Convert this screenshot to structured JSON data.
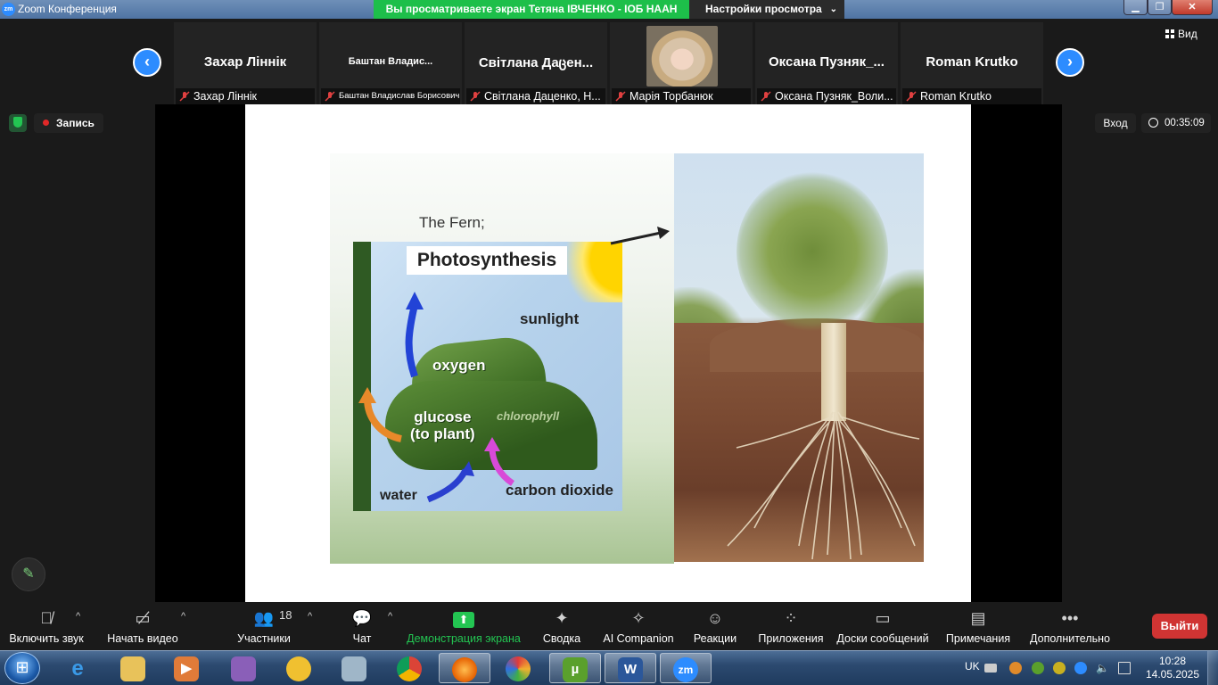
{
  "window": {
    "title": "Zoom Конференция",
    "logo_text": "zm",
    "share_banner": "Вы просматриваете экран Тетяна ІВЧЕНКО - ІОБ НААН",
    "view_settings": "Настройки просмотра",
    "minimize": "▁",
    "maximize": "❐",
    "close": "✕"
  },
  "participants": [
    {
      "display": "Захар Ліннік",
      "label": "Захар Ліннік"
    },
    {
      "display": "Баштан Владис...",
      "label": "Баштан Владислав Борисович"
    },
    {
      "display": "Світлана Даცен...",
      "label": "Світлана Даценко, Н..."
    },
    {
      "display": "",
      "label": "Марія Торбанюк",
      "has_photo": true
    },
    {
      "display": "Оксана Пузняк_...",
      "label": "Оксана Пузняк_Воли..."
    },
    {
      "display": "Roman Krutko",
      "label": "Roman Krutko"
    }
  ],
  "nav": {
    "prev": "‹",
    "next": "›"
  },
  "view_label": "Вид",
  "status": {
    "recording": "Запись",
    "enter": "Вход",
    "timer": "00:35:09"
  },
  "slide": {
    "fern_label": "The Fern;",
    "title": "Photosynthesis",
    "sunlight": "sunlight",
    "oxygen": "oxygen",
    "glucose": "glucose\n(to plant)",
    "chlorophyll": "chlorophyll",
    "water": "water",
    "carbon_dioxide": "carbon dioxide"
  },
  "toolbar": {
    "mute": "Включить звук",
    "video": "Начать видео",
    "participants": "Участники",
    "participants_count": "18",
    "chat": "Чат",
    "share": "Демонстрация экрана",
    "summary": "Сводка",
    "ai": "AI Companion",
    "reactions": "Реакции",
    "apps": "Приложения",
    "boards": "Доски сообщений",
    "notes": "Примечания",
    "more": "Дополнительно",
    "leave": "Выйти"
  },
  "taskbar": {
    "lang": "UK",
    "time": "10:28",
    "date": "14.05.2025",
    "word_letter": "W",
    "zoom_letter": "zm"
  },
  "colors": {
    "zoom_blue": "#2d8cff",
    "share_green": "#23c552",
    "leave_red": "#d03433"
  }
}
